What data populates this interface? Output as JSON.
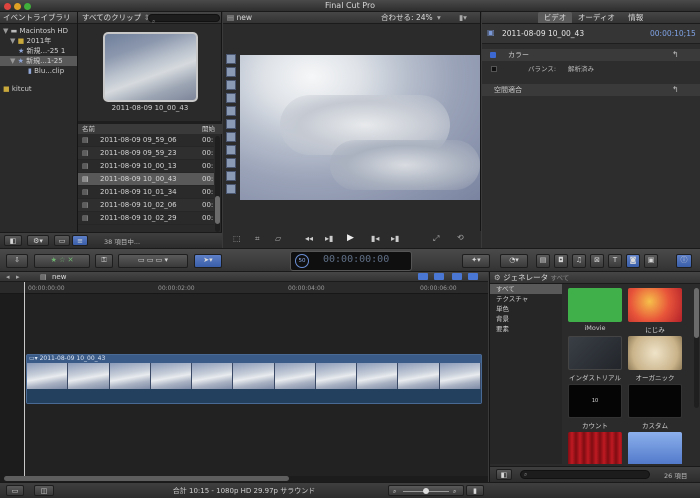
{
  "app": {
    "title": "Final Cut Pro"
  },
  "library": {
    "header_left": "イベントライブラリ",
    "header_right": "すべてのクリップ",
    "items": [
      {
        "label": "Macintosh HD"
      },
      {
        "label": "2011年"
      },
      {
        "label": "新規...-25 1"
      },
      {
        "label": "新規...1-25"
      },
      {
        "label": "Blu...clip"
      },
      {
        "label": "kitcut"
      }
    ],
    "footer_count": "38 項目中..."
  },
  "browser": {
    "thumbnail_caption": "2011-08-09 10_00_43",
    "columns": {
      "name": "名前",
      "start": "開始"
    },
    "rows": [
      {
        "name": "2011-08-09 09_59_06",
        "start": "00:"
      },
      {
        "name": "2011-08-09 09_59_23",
        "start": "00:"
      },
      {
        "name": "2011-08-09 10_00_13",
        "start": "00:"
      },
      {
        "name": "2011-08-09 10_00_43",
        "start": "00:"
      },
      {
        "name": "2011-08-09 10_01_34",
        "start": "00:"
      },
      {
        "name": "2011-08-09 10_02_06",
        "start": "00:"
      },
      {
        "name": "2011-08-09 10_02_29",
        "start": "00:"
      }
    ]
  },
  "viewer": {
    "name": "new",
    "fit_label": "合わせる:",
    "zoom": "24%"
  },
  "inspector": {
    "tabs": [
      "ビデオ",
      "オーディオ",
      "情報"
    ],
    "clip_name": "2011-08-09 10_00_43",
    "timecode": "00:00:10;15",
    "section_color": "カラー",
    "balance_label": "バランス:",
    "balance_value": "解析済み",
    "section_spatial": "空間適合"
  },
  "dashboard": {
    "timecode": "00:00:00:00",
    "percent": "50"
  },
  "timeline": {
    "project_name": "new",
    "ruler": [
      "00:00:00:00",
      "00:00:02:00",
      "00:00:04:00",
      "00:00:06:00"
    ],
    "clip_label": "2011-08-09 10_00_43"
  },
  "generators": {
    "header": "ジェネレータ",
    "header_sub": "すべて",
    "categories": [
      "すべて",
      "テクスチャ",
      "単色",
      "背景",
      "要素"
    ],
    "tiles": [
      {
        "label": "iMovie",
        "color": "#3fb04a"
      },
      {
        "label": "にじみ",
        "color": "#e8553a"
      },
      {
        "label": "インダストリアル",
        "color": "#2c3036"
      },
      {
        "label": "オーガニック",
        "color": "#d9c8a8"
      },
      {
        "label": "カウント",
        "color": "#050505"
      },
      {
        "label": "カスタム",
        "color": "#050505"
      },
      {
        "label": "",
        "color": "#a0141a"
      },
      {
        "label": "",
        "color": "#6b8fd8"
      }
    ],
    "count": "26 項目"
  },
  "statusbar": {
    "text": "合計 10:15 - 1080p HD 29.97p サラウンド"
  }
}
